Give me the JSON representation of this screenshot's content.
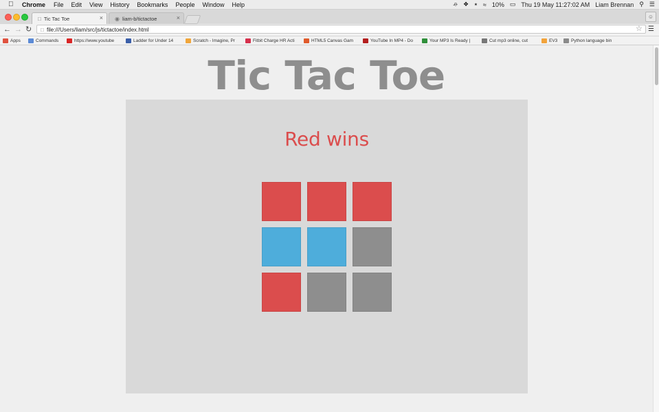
{
  "menubar": {
    "app": "Chrome",
    "items": [
      "File",
      "Edit",
      "View",
      "History",
      "Bookmarks",
      "People",
      "Window",
      "Help"
    ],
    "battery": "10%",
    "clock": "Thu 19 May  11:27:02 AM",
    "user": "Liam Brennan"
  },
  "tabs": [
    {
      "title": "Tic Tac Toe",
      "active": true
    },
    {
      "title": "liam-b/tictactoe",
      "active": false
    }
  ],
  "toolbar": {
    "url": "file:///Users/liam/src/js/tictactoe/index.html"
  },
  "bookmarks": [
    {
      "label": "Apps",
      "color": "#e0523f"
    },
    {
      "label": "Commands",
      "color": "#5b8ad6"
    },
    {
      "label": "https://www.youtube",
      "color": "#d92525"
    },
    {
      "label": "Ladder for Under 14",
      "color": "#3a5ea8"
    },
    {
      "label": "Scratch - Imagine, Pr",
      "color": "#f0a53a"
    },
    {
      "label": "Fitbit Charge HR Acti",
      "color": "#d6304c"
    },
    {
      "label": "HTML5 Canvas Gam",
      "color": "#e05a2b"
    },
    {
      "label": "YouTube In MP4 - Do",
      "color": "#b31e1e"
    },
    {
      "label": "Your MP3 Is Ready |",
      "color": "#2f8f3a"
    },
    {
      "label": "Cut mp3 online, cut",
      "color": "#777777"
    },
    {
      "label": "EV3",
      "color": "#f2a33a"
    },
    {
      "label": "Python language bin",
      "color": "#8a8a8a"
    }
  ],
  "page": {
    "title": "Tic Tac Toe",
    "status": "Red wins"
  },
  "board": {
    "cells": [
      "red",
      "red",
      "red",
      "blue",
      "blue",
      "empty",
      "red",
      "empty",
      "empty"
    ]
  },
  "colors": {
    "red": "#db4d4d",
    "blue": "#4eaddb",
    "empty": "#8e8e8e"
  }
}
